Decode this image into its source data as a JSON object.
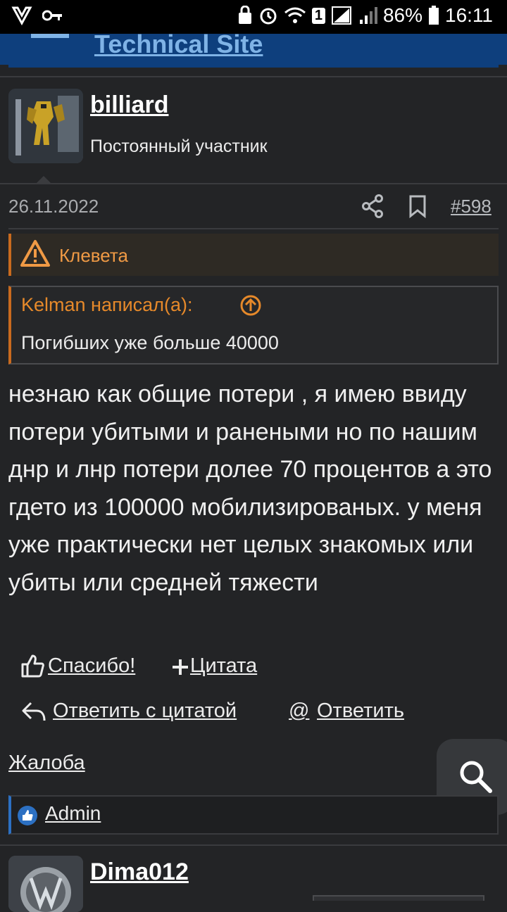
{
  "status_bar": {
    "battery": "86%",
    "time": "16:11",
    "sim_badge": "1"
  },
  "header": {
    "site_title": "Technical Site"
  },
  "post": {
    "author": "billiard",
    "author_title": "Постоянный участник",
    "date": "26.11.2022",
    "number": "#598",
    "warning_label": "Клевета",
    "quote": {
      "author": "Kelman написал(а):",
      "text": "Погибших уже больше 40000"
    },
    "text": "незнаю как общие потери , я имею ввиду потери убитыми и ранеными но по нашим днр и лнр потери долее 70 процентов а это гдето из 100000 мобилизированых. у меня уже практически нет целых знакомых или убиты или средней тяжести",
    "actions": {
      "thanks": "Спасибо!",
      "quote": "Цитата",
      "reply_quote": "Ответить с цитатой",
      "reply": "Ответить",
      "report": "Жалоба"
    },
    "reaction_user": "Admin"
  },
  "next_post": {
    "author": "Dima012"
  },
  "colors": {
    "background": "#232426",
    "accent_orange": "#e6892a",
    "banner_blue": "#0e3f7d",
    "reaction_blue": "#2c70c2"
  }
}
